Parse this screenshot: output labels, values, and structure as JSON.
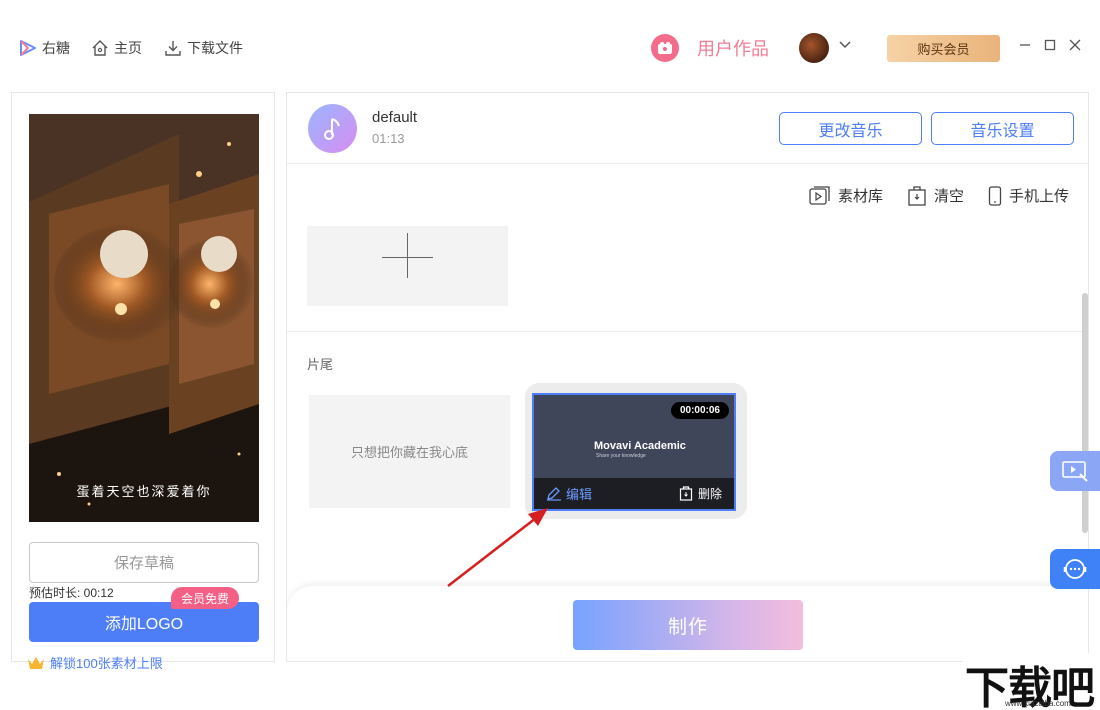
{
  "nav": {
    "app_name": "右糖",
    "home": "主页",
    "downloads": "下载文件"
  },
  "header": {
    "user_works": "用户作品",
    "buy_vip": "购买会员"
  },
  "left": {
    "preview_caption": "蛋着天空也深爱着你",
    "save_draft": "保存草稿",
    "duration": "预估时长: 00:12",
    "free_tag": "会员免费",
    "add_logo": "添加LOGO",
    "unlock": "解锁100张素材上限"
  },
  "music": {
    "name": "default",
    "time": "01:13",
    "change": "更改音乐",
    "settings": "音乐设置"
  },
  "tools": {
    "library": "素材库",
    "clear": "清空",
    "phone_upload": "手机上传"
  },
  "ending": {
    "label": "片尾",
    "text_tile": "只想把你藏在我心底",
    "video_duration": "00:00:06",
    "video_title": "Movavi Academic",
    "video_sub": "Share your knowledge",
    "edit": "编辑",
    "delete": "删除"
  },
  "bottom": {
    "make": "制作"
  },
  "watermark": {
    "text": "下载吧",
    "url": "www.xiazaiba.com"
  },
  "colors": {
    "accent": "#4d7ef7",
    "pink": "#f47c94",
    "vip_gold": "#e9b47a"
  }
}
